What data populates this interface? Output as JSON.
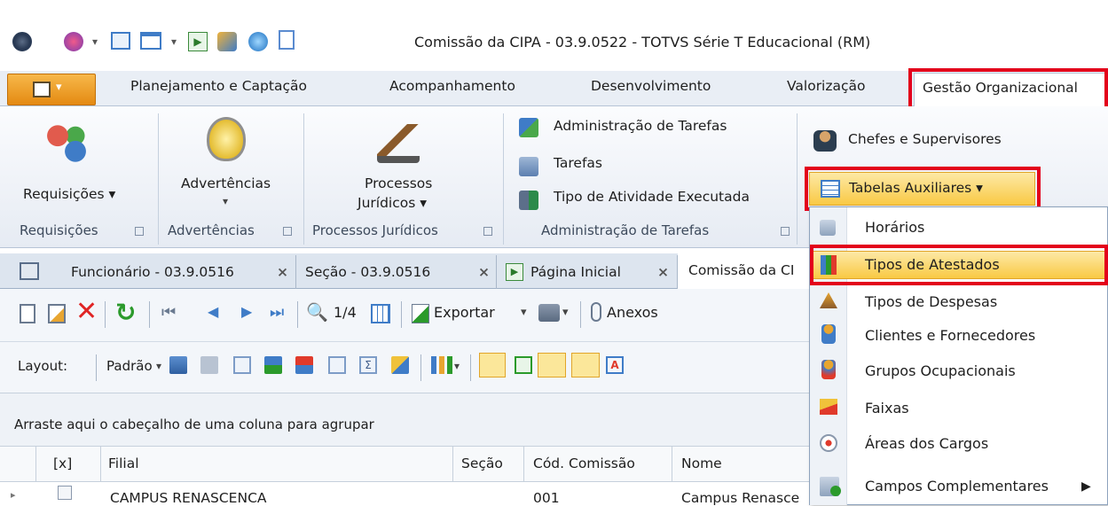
{
  "window": {
    "title": "Comissão da CIPA - 03.9.0522 - TOTVS Série T Educacional (RM)"
  },
  "ribbon_tabs": [
    "Planejamento e Captação",
    "Acompanhamento",
    "Desenvolvimento",
    "Valorização",
    "Gestão Organizacional"
  ],
  "ribbon": {
    "requisicoes_label": "Requisições ▾",
    "advertencias_label": "Advertências",
    "processos_line1": "Processos",
    "processos_line2": "Jurídicos ▾",
    "admin_tarefas": "Administração de Tarefas",
    "tarefas": "Tarefas",
    "tipo_atividade": "Tipo de Atividade Executada",
    "chefes": "Chefes e Supervisores",
    "tabelas_auxiliares": "Tabelas Auxiliares ▾",
    "groups": [
      "Requisições",
      "Advertências",
      "Processos Jurídicos",
      "Administração de Tarefas"
    ]
  },
  "doc_tabs": [
    "Funcionário - 03.9.0516",
    "Seção - 03.9.0516",
    "Página Inicial",
    "Comissão da CI"
  ],
  "toolbar": {
    "page_counter": "1/4",
    "exportar": "Exportar",
    "anexos": "Anexos",
    "layout_label": "Layout:",
    "padrao": "Padrão"
  },
  "group_panel_text": "Arraste aqui o cabeçalho de uma coluna para agrupar",
  "grid": {
    "columns": [
      "[x]",
      "Filial",
      "Seção",
      "Cód. Comissão",
      "Nome"
    ],
    "rows": [
      {
        "filial": "CAMPUS RENASCENCA",
        "secao": "",
        "cod": "001",
        "nome": "Campus Renasce"
      }
    ]
  },
  "dropdown": {
    "items": [
      "Horários",
      "Tipos de Atestados",
      "Tipos de Despesas",
      "Clientes e Fornecedores",
      "Grupos Ocupacionais",
      "Faixas",
      "Áreas dos Cargos",
      "Campos Complementares"
    ],
    "highlighted": "Tipos de Atestados"
  },
  "colors": {
    "highlight_box": "#e3001b",
    "menu_hover": "#f9c944",
    "app_button": "#e48a12"
  }
}
